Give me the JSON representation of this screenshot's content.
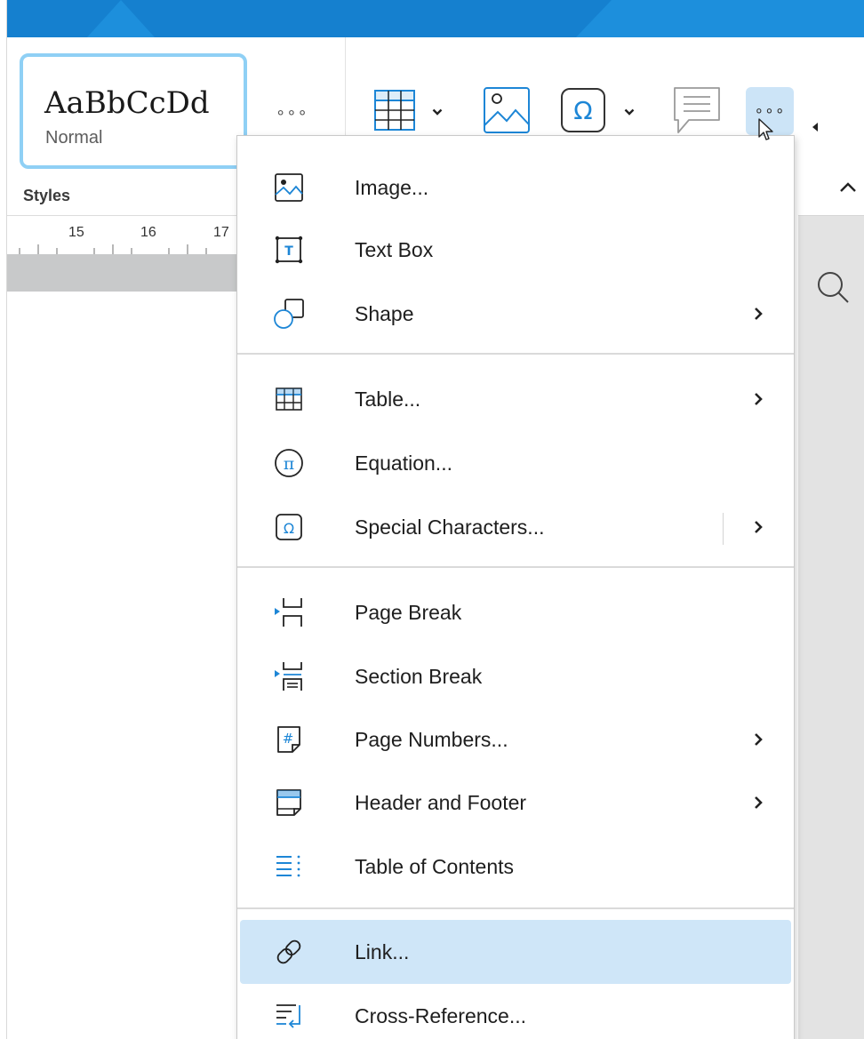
{
  "window": {
    "accent_color": "#1580cf"
  },
  "ribbon": {
    "style_gallery": {
      "sample_text": "AaBbCcDd",
      "style_name": "Normal",
      "more_label": "...",
      "group_label": "Styles"
    },
    "buttons": [
      {
        "icon": "table-icon",
        "has_dropdown": true
      },
      {
        "icon": "image-icon",
        "has_dropdown": false
      },
      {
        "icon": "omega-icon",
        "has_dropdown": true
      },
      {
        "icon": "comment-icon",
        "has_dropdown": false
      }
    ],
    "more_button_label": "...",
    "selection_color": "#cce4f7"
  },
  "ruler": {
    "labels": [
      "15",
      "16",
      "17"
    ]
  },
  "menu": {
    "groups": [
      [
        {
          "label": "Image...",
          "icon": "image-icon",
          "submenu": false
        },
        {
          "label": "Text Box",
          "icon": "text-box-icon",
          "submenu": false
        },
        {
          "label": "Shape",
          "icon": "shape-icon",
          "submenu": true
        }
      ],
      [
        {
          "label": "Table...",
          "icon": "table-icon",
          "submenu": true
        },
        {
          "label": "Equation...",
          "icon": "pi-icon",
          "submenu": false
        },
        {
          "label": "Special Characters...",
          "icon": "omega-icon",
          "submenu": true
        }
      ],
      [
        {
          "label": "Page Break",
          "icon": "page-break-icon",
          "submenu": false
        },
        {
          "label": "Section Break",
          "icon": "section-break-icon",
          "submenu": false
        },
        {
          "label": "Page Numbers...",
          "icon": "page-numbers-icon",
          "submenu": true
        },
        {
          "label": "Header and Footer",
          "icon": "header-footer-icon",
          "submenu": true
        },
        {
          "label": "Table of Contents",
          "icon": "toc-icon",
          "submenu": false
        }
      ],
      [
        {
          "label": "Link...",
          "icon": "link-icon",
          "submenu": false,
          "highlighted": true
        },
        {
          "label": "Cross-Reference...",
          "icon": "cross-reference-icon",
          "submenu": false
        }
      ]
    ],
    "highlight_color": "#cfe6f8",
    "icon_color": "#1d86d6"
  }
}
